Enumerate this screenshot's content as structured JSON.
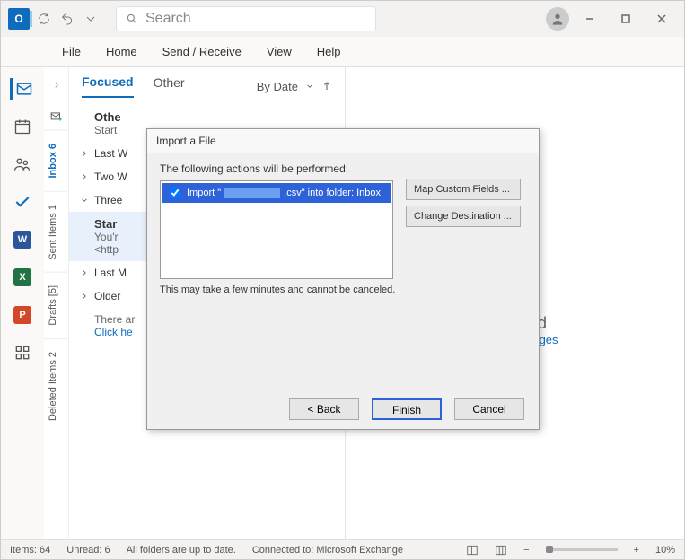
{
  "titlebar": {
    "search_placeholder": "Search"
  },
  "ribbon": {
    "file": "File",
    "home": "Home",
    "send_receive": "Send / Receive",
    "view": "View",
    "help": "Help"
  },
  "folders": {
    "inbox": "Inbox  6",
    "sent": "Sent Items  1",
    "drafts": "Drafts [5]",
    "deleted": "Deleted Items  2"
  },
  "msgtabs": {
    "focused": "Focused",
    "other": "Other",
    "bydate": "By Date"
  },
  "messages": {
    "other_title": "Othe",
    "other_sub": "Start",
    "group_lastw": "Last W",
    "group_twow": "Two W",
    "group_threew": "Three",
    "star_title": "Star",
    "star_line1": "You'r",
    "star_line2": "<http",
    "group_lastm": "Last M",
    "group_older": "Older",
    "footer1": "There ar",
    "footer_link": "Click he"
  },
  "reading": {
    "headline_suffix": "n to read",
    "link_suffix": "eview messages"
  },
  "dialog": {
    "title": "Import a File",
    "instruction": "The following actions will be performed:",
    "row_prefix": "Import \"",
    "row_mid": ".csv\" into folder: Inbox",
    "map_fields": "Map Custom Fields ...",
    "change_dest": "Change Destination ...",
    "note": "This may take a few minutes and cannot be canceled.",
    "back": "< Back",
    "finish": "Finish",
    "cancel": "Cancel"
  },
  "status": {
    "items": "Items: 64",
    "unread": "Unread: 6",
    "uptodate": "All folders are up to date.",
    "connected": "Connected to: Microsoft Exchange",
    "zoom": "10%"
  }
}
